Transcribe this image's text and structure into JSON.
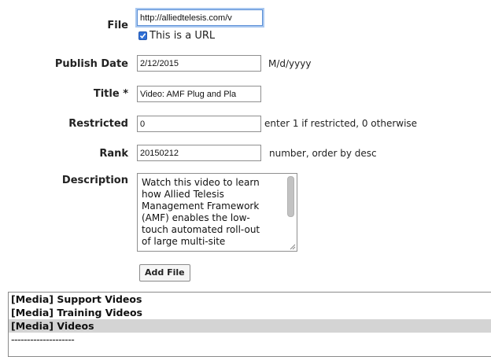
{
  "form": {
    "file": {
      "label": "File",
      "value": "http://alliedtelesis.com/v",
      "url_checkbox_label": "This is a URL",
      "url_checked": true
    },
    "publish_date": {
      "label": "Publish Date",
      "value": "2/12/2015",
      "hint": "M/d/yyyy"
    },
    "title": {
      "label": "Title *",
      "value": "Video: AMF Plug and Pla"
    },
    "restricted": {
      "label": "Restricted",
      "value": "0",
      "hint": "enter 1 if restricted, 0 otherwise"
    },
    "rank": {
      "label": "Rank",
      "value": "20150212",
      "hint": "number, order by desc"
    },
    "description": {
      "label": "Description",
      "value": "Watch this video to learn\nhow Allied Telesis\nManagement Framework\n(AMF) enables the low-\ntouch automated roll-out\nof large multi-site"
    },
    "add_button_label": "Add File"
  },
  "category_list": {
    "items": [
      "[Media] Support Videos",
      "[Media] Training Videos",
      "[Media] Videos",
      "--------------------"
    ],
    "selected_index": 2
  },
  "colors": {
    "checkbox": "#2f6fd6",
    "focus_ring": "#5b8fd6",
    "selected_row": "#d4d4d4"
  }
}
